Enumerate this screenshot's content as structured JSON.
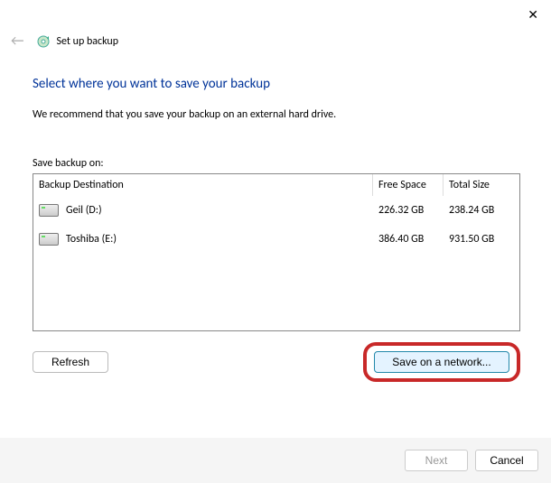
{
  "window": {
    "title": "Set up backup"
  },
  "page": {
    "title": "Select where you want to save your backup",
    "recommendation": "We recommend that you save your backup on an external hard drive.",
    "save_label": "Save backup on:"
  },
  "columns": {
    "destination": "Backup Destination",
    "free": "Free Space",
    "total": "Total Size"
  },
  "drives": [
    {
      "name": "Geil (D:)",
      "free": "226.32 GB",
      "total": "238.24 GB"
    },
    {
      "name": "Toshiba (E:)",
      "free": "386.40 GB",
      "total": "931.50 GB"
    }
  ],
  "buttons": {
    "refresh": "Refresh",
    "network": "Save on a network...",
    "next": "Next",
    "cancel": "Cancel"
  }
}
